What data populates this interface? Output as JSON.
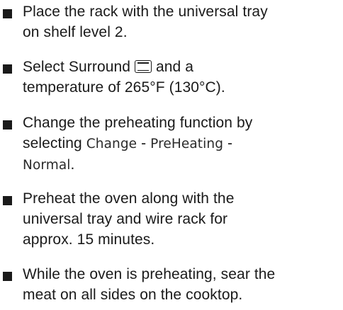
{
  "steps": [
    {
      "lines": [
        "Place the rack with the universal tray",
        "on shelf level 2."
      ]
    },
    {
      "line1_before_icon": "Select Surround",
      "line1_after_icon": "and a",
      "icon": "surround-heating-icon",
      "line2": "temperature of 265°F (130°C)."
    },
    {
      "line1": "Change the preheating function by",
      "line2_prefix": "selecting",
      "menu_change": "Change",
      "separator1": " - ",
      "menu_preheating": "PreHeating",
      "separator2": " -",
      "menu_normal": "Normal",
      "line3_suffix": "."
    },
    {
      "lines": [
        "Preheat the oven along with the",
        "universal tray and wire rack for",
        "approx. 15 minutes."
      ]
    },
    {
      "lines": [
        "While the oven is preheating, sear the",
        "meat on all sides on the cooktop."
      ]
    }
  ]
}
